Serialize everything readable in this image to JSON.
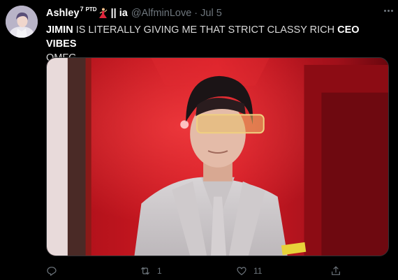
{
  "tweet": {
    "display_name": "Ashley",
    "name_superscript": "7",
    "name_ptd": "PTD",
    "name_suffix": "|| ia",
    "handle": "@AlfminLove",
    "separator": "·",
    "date": "Jul 5",
    "text_part1": "JIMIN",
    "text_part2": " IS LITERALLY GIVING ME THAT STRICT CLASSY RICH ",
    "text_part3": "CEO VIBES",
    "text_line2": "OMFG",
    "reply_count": "",
    "retweet_count": "1",
    "like_count": "11"
  },
  "icons": {
    "dancer": "woman-dancing-emoji",
    "more": "more-dots-icon",
    "reply": "reply-icon",
    "retweet": "retweet-icon",
    "like": "heart-icon",
    "share": "share-icon"
  },
  "colors": {
    "background": "#000000",
    "secondary_text": "#6e767d",
    "primary_text": "#d9d9d9",
    "media_red": "#c8141e"
  }
}
